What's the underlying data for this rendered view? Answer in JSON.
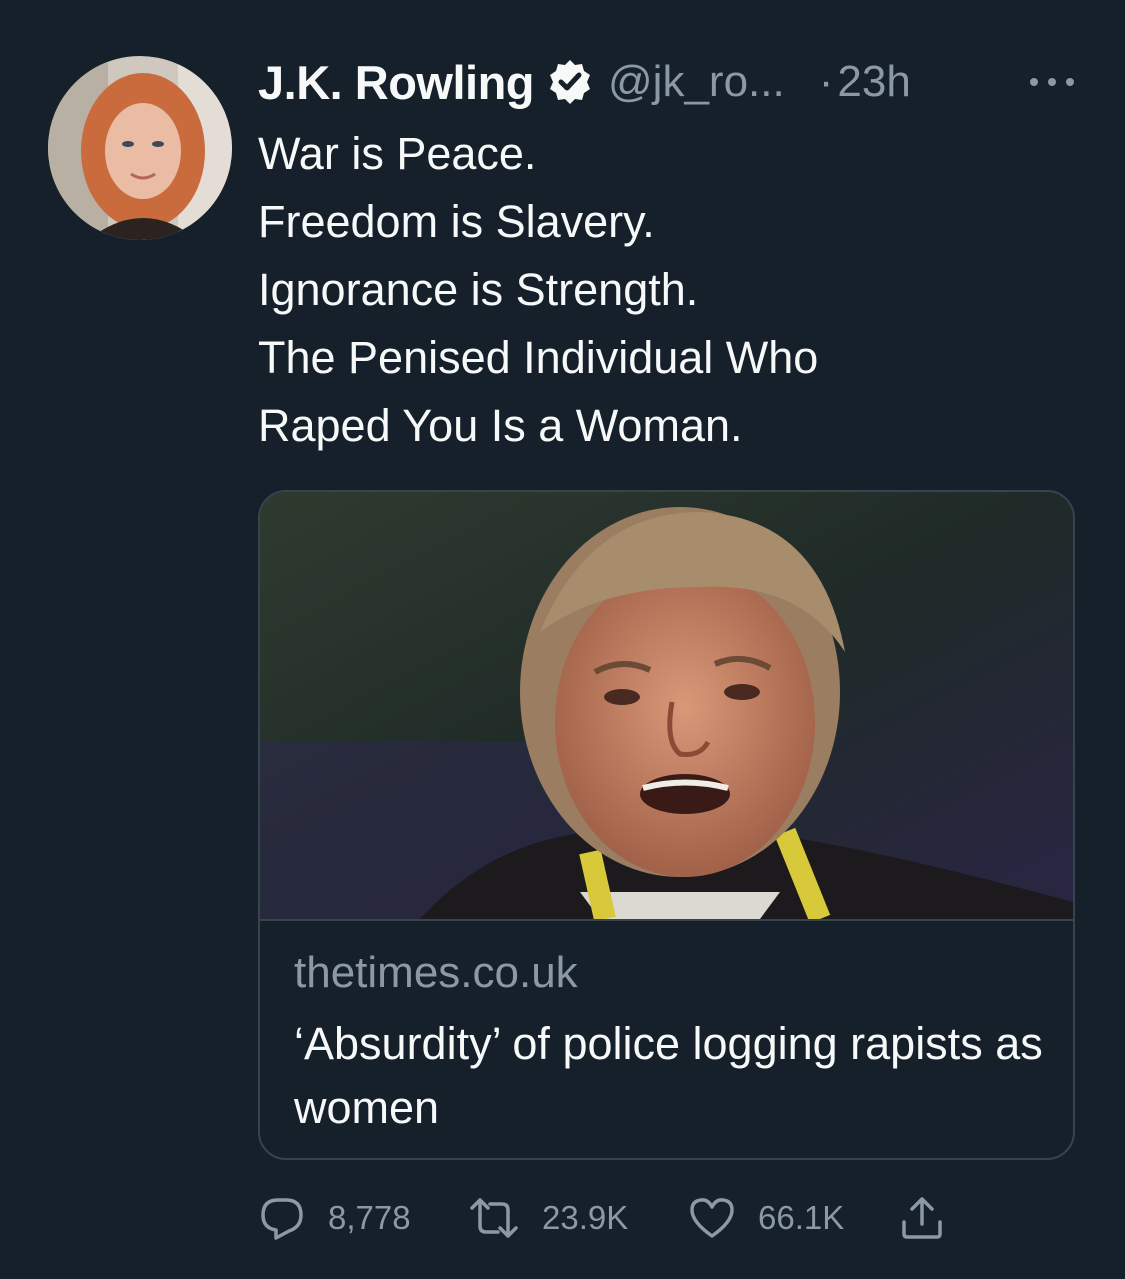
{
  "tweet": {
    "author": {
      "display_name": "J.K. Rowling",
      "handle": "@jk_ro...",
      "verified": true
    },
    "separator": "·",
    "timestamp": "23h",
    "text_lines": [
      "War is Peace.",
      "Freedom is Slavery.",
      "Ignorance is Strength.",
      "The Penised Individual Who",
      "Raped You Is a Woman."
    ]
  },
  "link_card": {
    "domain": "thetimes.co.uk",
    "title": "‘Absurdity’ of police logging rapists as women"
  },
  "actions": {
    "replies": "8,778",
    "retweets": "23.9K",
    "likes": "66.1K"
  },
  "colors": {
    "background": "#15202b",
    "text_primary": "#f7f9f9",
    "text_secondary": "#8b98a5",
    "border": "#38444d"
  },
  "icons": {
    "verified": "verified-badge-icon",
    "more": "more-options-icon",
    "reply": "reply-icon",
    "retweet": "retweet-icon",
    "like": "heart-icon",
    "share": "share-icon"
  }
}
